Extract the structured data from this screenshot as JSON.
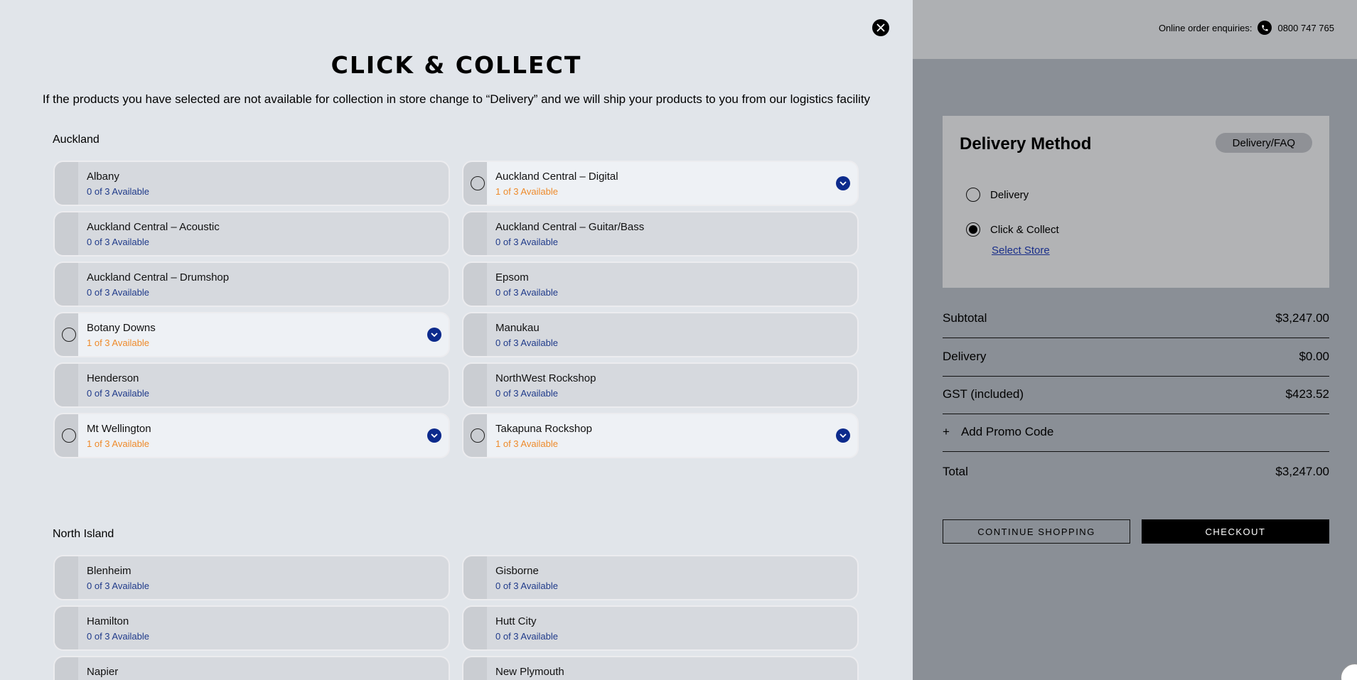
{
  "modal": {
    "title": "CLICK & COLLECT",
    "description": "If the products you have selected are not available for collection in store change to “Delivery” and we will ship your products to you from our logistics facility",
    "regions": [
      {
        "name": "Auckland",
        "stores": [
          {
            "name": "Albany",
            "availability": "0 of 3 Available",
            "available": false
          },
          {
            "name": "Auckland Central – Digital",
            "availability": "1 of 3 Available",
            "available": true
          },
          {
            "name": "Auckland Central – Acoustic",
            "availability": "0 of 3 Available",
            "available": false
          },
          {
            "name": "Auckland Central – Guitar/Bass",
            "availability": "0 of 3 Available",
            "available": false
          },
          {
            "name": "Auckland Central – Drumshop",
            "availability": "0 of 3 Available",
            "available": false
          },
          {
            "name": "Epsom",
            "availability": "0 of 3 Available",
            "available": false
          },
          {
            "name": "Botany Downs",
            "availability": "1 of 3 Available",
            "available": true
          },
          {
            "name": "Manukau",
            "availability": "0 of 3 Available",
            "available": false
          },
          {
            "name": "Henderson",
            "availability": "0 of 3 Available",
            "available": false
          },
          {
            "name": "NorthWest Rockshop",
            "availability": "0 of 3 Available",
            "available": false
          },
          {
            "name": "Mt Wellington",
            "availability": "1 of 3 Available",
            "available": true
          },
          {
            "name": "Takapuna Rockshop",
            "availability": "1 of 3 Available",
            "available": true
          }
        ]
      },
      {
        "name": "North Island",
        "stores": [
          {
            "name": "Blenheim",
            "availability": "0 of 3 Available",
            "available": false
          },
          {
            "name": "Gisborne",
            "availability": "0 of 3 Available",
            "available": false
          },
          {
            "name": "Hamilton",
            "availability": "0 of 3 Available",
            "available": false
          },
          {
            "name": "Hutt City",
            "availability": "0 of 3 Available",
            "available": false
          },
          {
            "name": "Napier",
            "availability": "",
            "available": false
          },
          {
            "name": "New Plymouth",
            "availability": "",
            "available": false
          }
        ]
      }
    ]
  },
  "header": {
    "enquiries_label": "Online order enquiries:",
    "phone": "0800 747 765"
  },
  "delivery_method": {
    "title": "Delivery Method",
    "faq_label": "Delivery/FAQ",
    "options": [
      {
        "label": "Delivery",
        "selected": false
      },
      {
        "label": "Click & Collect",
        "selected": true
      }
    ],
    "select_store_label": "Select Store"
  },
  "summary": {
    "subtotal_label": "Subtotal",
    "subtotal_value": "$3,247.00",
    "delivery_label": "Delivery",
    "delivery_value": "$0.00",
    "gst_label": "GST (included)",
    "gst_value": "$423.52",
    "promo_label": "Add Promo Code",
    "promo_icon": "+",
    "total_label": "Total",
    "total_value": "$3,247.00"
  },
  "actions": {
    "continue_label": "CONTINUE SHOPPING",
    "checkout_label": "CHECKOUT"
  },
  "colors": {
    "accent_blue": "#0c2a8c",
    "available_orange": "#ee8a2a",
    "unavailable_blue": "#1f3a8a"
  }
}
